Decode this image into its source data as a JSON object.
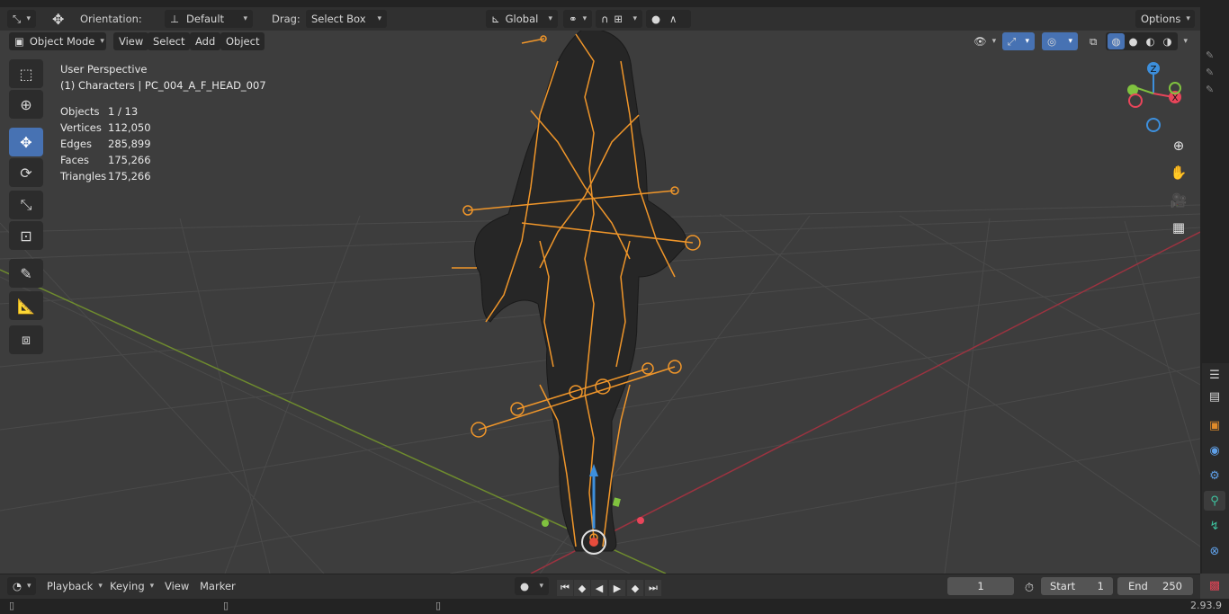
{
  "header": {
    "orientation_label": "Orientation:",
    "orientation_value": "Default",
    "drag_label": "Drag:",
    "drag_value": "Select Box",
    "transform_space": "Global",
    "options_label": "Options"
  },
  "menu": {
    "mode": "Object Mode",
    "items": [
      "View",
      "Select",
      "Add",
      "Object"
    ]
  },
  "overlay_text": {
    "perspective": "User Perspective",
    "collection": "(1) Characters | PC_004_A_F_HEAD_007"
  },
  "stats": [
    {
      "label": "Objects",
      "value": "1 / 13"
    },
    {
      "label": "Vertices",
      "value": "112,050"
    },
    {
      "label": "Edges",
      "value": "285,899"
    },
    {
      "label": "Faces",
      "value": "175,266"
    },
    {
      "label": "Triangles",
      "value": "175,266"
    }
  ],
  "gizmo": {
    "z_label": "Z",
    "x_label": "X",
    "colors": {
      "x": "#e8455a",
      "y": "#80c23f",
      "z": "#3d8fdc"
    }
  },
  "tools": [
    "select-box",
    "cursor",
    "move",
    "rotate",
    "scale",
    "transform",
    "annotate",
    "measure",
    "add-cube"
  ],
  "timeline": {
    "menus": [
      "Playback",
      "Keying",
      "View",
      "Marker"
    ],
    "current_frame": "1",
    "start_label": "Start",
    "start_value": "1",
    "end_label": "End",
    "end_value": "250"
  },
  "status": {
    "version": "2.93.9"
  },
  "colors": {
    "accent": "#4772b3",
    "armature": "#f0962a",
    "grid_x_axis": "#9c3340",
    "grid_y_axis": "#6e8b2e"
  }
}
